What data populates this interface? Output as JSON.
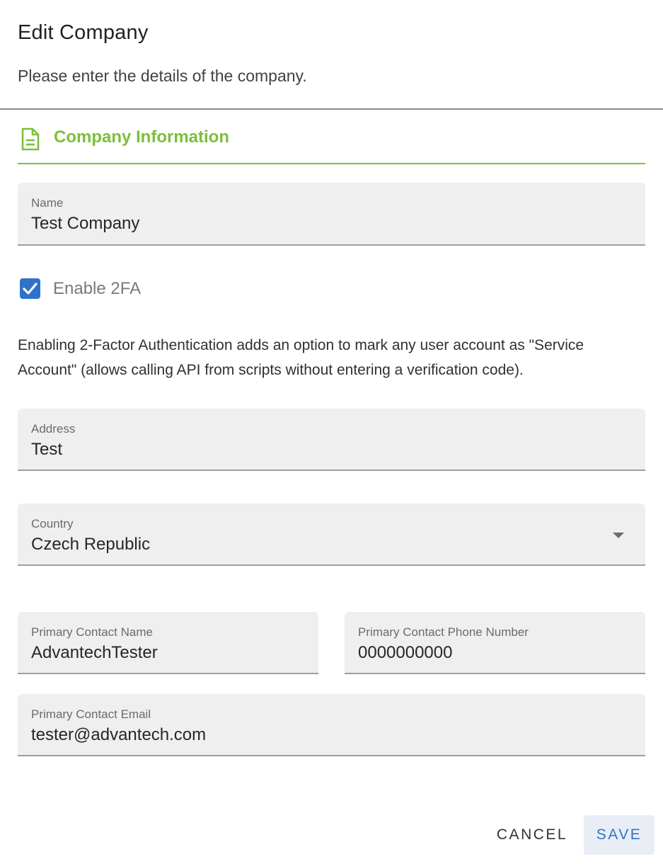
{
  "dialog": {
    "title": "Edit Company",
    "subtitle": "Please enter the details of the company."
  },
  "section": {
    "title": "Company Information",
    "icon": "document-icon",
    "accent_color": "#7cbf3a"
  },
  "fields": {
    "name": {
      "label": "Name",
      "value": "Test Company"
    },
    "address": {
      "label": "Address",
      "value": "Test"
    },
    "country": {
      "label": "Country",
      "value": "Czech Republic"
    },
    "contact_name": {
      "label": "Primary Contact Name",
      "value": "AdvantechTester"
    },
    "contact_phone": {
      "label": "Primary Contact Phone Number",
      "value": "0000000000"
    },
    "contact_email": {
      "label": "Primary Contact Email",
      "value": "tester@advantech.com"
    }
  },
  "two_fa": {
    "label": "Enable 2FA",
    "checked": true,
    "help_text": "Enabling 2-Factor Authentication adds an option to mark any user account as \"Service Account\" (allows calling API from scripts without entering a verification code)."
  },
  "actions": {
    "cancel_label": "CANCEL",
    "save_label": "SAVE",
    "primary_color": "#2f73c9"
  }
}
